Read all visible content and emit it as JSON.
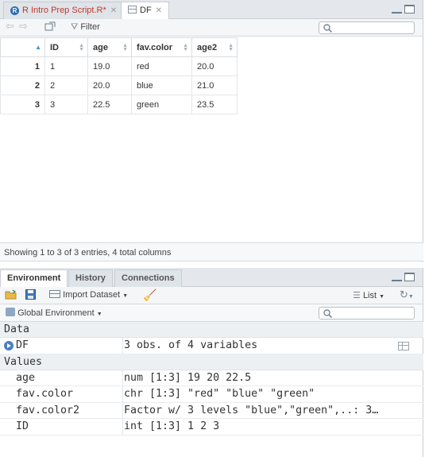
{
  "source_pane": {
    "tabs": [
      {
        "label": "R Intro Prep Script.R*",
        "active": false
      },
      {
        "label": "DF",
        "active": true
      }
    ],
    "toolbar": {
      "filter_label": "Filter",
      "search_placeholder": ""
    },
    "table": {
      "columns": [
        "",
        "ID",
        "age",
        "fav.color",
        "age2"
      ],
      "rows": [
        {
          "rownum": "1",
          "ID": "1",
          "age": "19.0",
          "fav_color": "red",
          "age2": "20.0"
        },
        {
          "rownum": "2",
          "ID": "2",
          "age": "20.0",
          "fav_color": "blue",
          "age2": "21.0"
        },
        {
          "rownum": "3",
          "ID": "3",
          "age": "22.5",
          "fav_color": "green",
          "age2": "23.5"
        }
      ]
    },
    "status": "Showing 1 to 3 of 3 entries, 4 total columns"
  },
  "env_pane": {
    "tabs": [
      {
        "label": "Environment",
        "active": true
      },
      {
        "label": "History",
        "active": false
      },
      {
        "label": "Connections",
        "active": false
      }
    ],
    "toolbar": {
      "import_label": "Import Dataset",
      "view_label": "List"
    },
    "scope_label": "Global Environment",
    "data_section": "Data",
    "data_items": [
      {
        "name": "DF",
        "value": "3 obs. of 4 variables"
      }
    ],
    "values_section": "Values",
    "value_items": [
      {
        "name": "age",
        "value": "num [1:3] 19 20 22.5"
      },
      {
        "name": "fav.color",
        "value": "chr [1:3] \"red\" \"blue\" \"green\""
      },
      {
        "name": "fav.color2",
        "value": "Factor w/ 3 levels \"blue\",\"green\",..: 3…"
      },
      {
        "name": "ID",
        "value": "int [1:3] 1 2 3"
      }
    ]
  },
  "colors": {
    "modified_tab": "#c0392b",
    "accent": "#4a7fc1"
  }
}
